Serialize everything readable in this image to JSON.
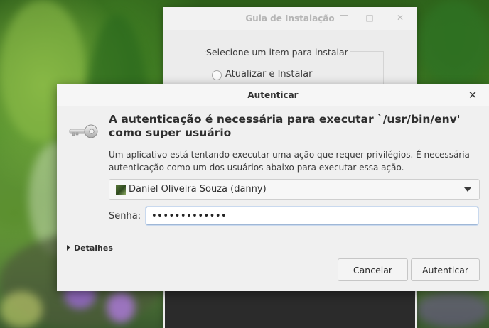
{
  "background_window": {
    "title": "Guia de Instalação",
    "group_label": "Selecione um item para instalar",
    "option_label": "Atualizar e Instalar"
  },
  "dialog": {
    "title": "Autenticar",
    "heading": "A autenticação é necessária para executar `/usr/bin/env' como super usuário",
    "description": "Um aplicativo está tentando executar uma ação que requer privilégios. É necessária autenticação como um dos usuários abaixo para executar essa ação.",
    "user_selected": "Daniel Oliveira Souza (danny)",
    "password_label": "Senha:",
    "password_value": "•••••••••••••",
    "details_label": "Detalhes",
    "cancel_label": "Cancelar",
    "ok_label": "Autenticar"
  },
  "icons": {
    "dialog_icon": "key-icon",
    "close": "close-icon",
    "dropdown": "chevron-down-icon",
    "details": "triangle-right-icon"
  }
}
